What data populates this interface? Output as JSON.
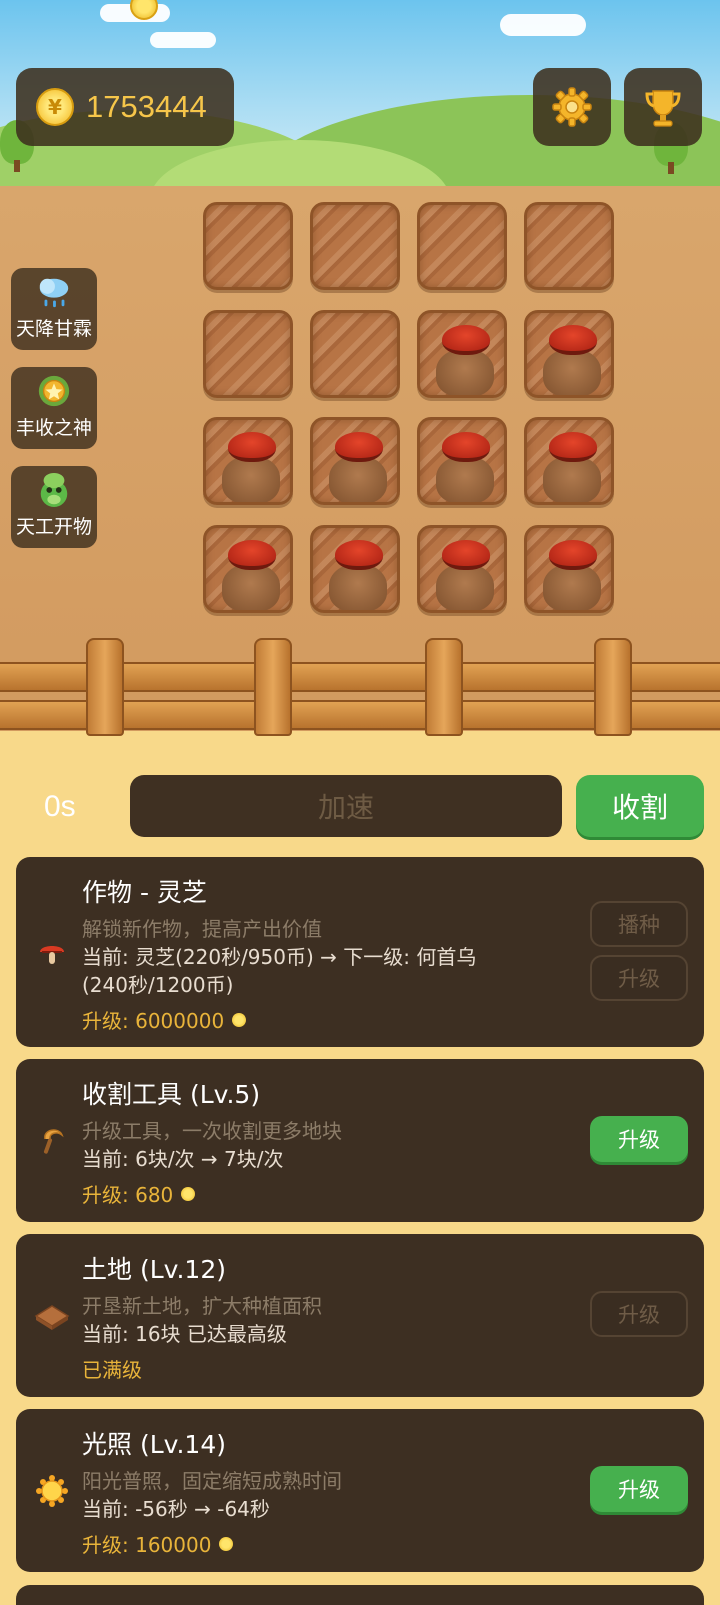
{
  "hud": {
    "coins": "1753444",
    "coin_icon": "coin-icon",
    "settings_icon": "gear-icon",
    "trophy_icon": "trophy-icon"
  },
  "side_buttons": [
    {
      "label": "天降甘霖",
      "icon": "rain-cloud-icon"
    },
    {
      "label": "丰收之神",
      "icon": "harvest-medal-icon"
    },
    {
      "label": "天工开物",
      "icon": "green-creature-icon"
    }
  ],
  "field": {
    "rows": 4,
    "cols": 4,
    "plots": [
      "empty",
      "empty",
      "empty",
      "empty",
      "empty",
      "empty",
      "lingzhi",
      "lingzhi",
      "lingzhi",
      "lingzhi",
      "lingzhi",
      "lingzhi",
      "lingzhi",
      "lingzhi",
      "lingzhi",
      "lingzhi"
    ]
  },
  "actions": {
    "timer": "0s",
    "speed_label": "加速",
    "harvest_label": "收割"
  },
  "cards": [
    {
      "icon": "mushroom-icon",
      "title": "作物 - 灵芝",
      "desc": "解锁新作物，提高产出价值",
      "current": "当前: 灵芝(220秒/950币) → 下一级: 何首乌(240秒/1200币)",
      "cost": "升级: 6000000",
      "buttons": [
        {
          "label": "播种",
          "enabled": false
        },
        {
          "label": "升级",
          "enabled": false
        }
      ]
    },
    {
      "icon": "sickle-icon",
      "title": "收割工具 (Lv.5)",
      "desc": "升级工具，一次收割更多地块",
      "current": "当前: 6块/次 → 7块/次",
      "cost": "升级: 680",
      "buttons": [
        {
          "label": "升级",
          "enabled": true
        }
      ]
    },
    {
      "icon": "land-tile-icon",
      "title": "土地 (Lv.12)",
      "desc": "开垦新土地，扩大种植面积",
      "current": "当前: 16块  已达最高级",
      "cost": "已满级",
      "buttons": [
        {
          "label": "升级",
          "enabled": false
        }
      ]
    },
    {
      "icon": "sun-icon",
      "title": "光照 (Lv.14)",
      "desc": "阳光普照，固定缩短成熟时间",
      "current": "当前: -56秒 → -64秒",
      "cost": "升级: 160000",
      "buttons": [
        {
          "label": "升级",
          "enabled": true
        }
      ]
    }
  ],
  "colors": {
    "accent_green": "#46b04e",
    "panel_brown": "#3d2f22",
    "coin_gold": "#f6c64a",
    "background": "#f8d98a"
  }
}
